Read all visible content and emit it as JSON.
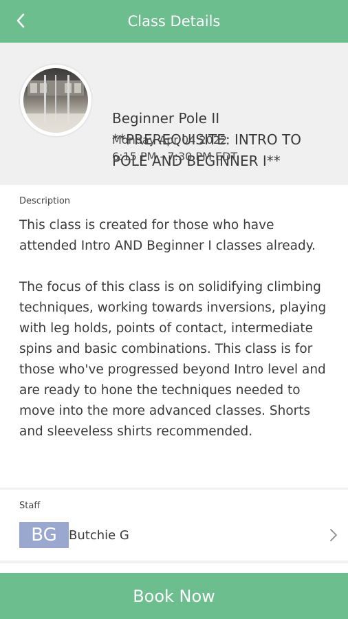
{
  "header": {
    "title": "Class Details",
    "back_icon": "chevron-left-icon"
  },
  "class": {
    "name": "Beginner Pole II **PREREQUISITE: INTRO TO POLE AND BEGINNER I**",
    "date": "Monday Apr 04 2022",
    "time": "6:15 PM - 7:30 PM EDT"
  },
  "description": {
    "label": "Description",
    "paragraphs": [
      "This class is created for those who have attended Intro AND Beginner I classes already.",
      "The focus of this class is on solidifying climbing techniques, working towards inversions, playing with leg holds, points of contact, intermediate spins and basic combinations. This class is for those who've progressed beyond Intro level and are ready to hone the techniques needed to move into the more advanced classes. Shorts and sleeveless shirts recommended."
    ]
  },
  "staff": {
    "label": "Staff",
    "initials": "BG",
    "name": "Butchie G",
    "badge_color": "#9aa7cf"
  },
  "footer": {
    "book_label": "Book Now"
  },
  "colors": {
    "accent": "#6dbe8e",
    "hero_bg": "#f0f0f0"
  }
}
